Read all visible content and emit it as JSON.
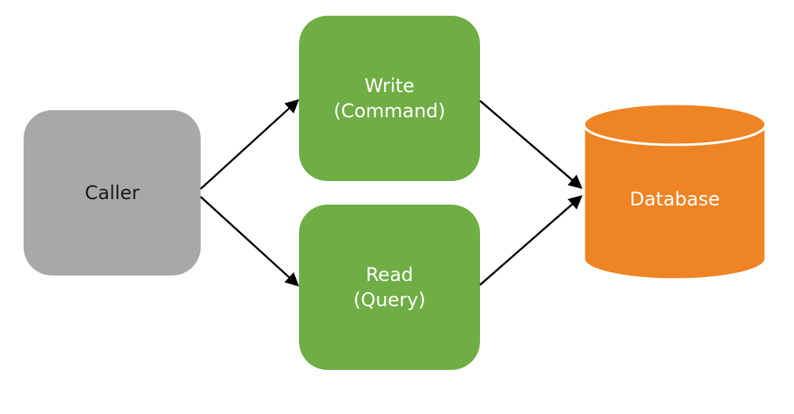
{
  "diagram": {
    "caller": {
      "label": "Caller"
    },
    "write": {
      "line1": "Write",
      "line2": "(Command)"
    },
    "read": {
      "line1": "Read",
      "line2": "(Query)"
    },
    "database": {
      "label": "Database"
    }
  },
  "colors": {
    "grey": "#a8a8a8",
    "green": "#6fae44",
    "orange": "#EE8423",
    "text_dark": "#191919",
    "text_light": "#ffffff",
    "arrow": "#000000"
  }
}
